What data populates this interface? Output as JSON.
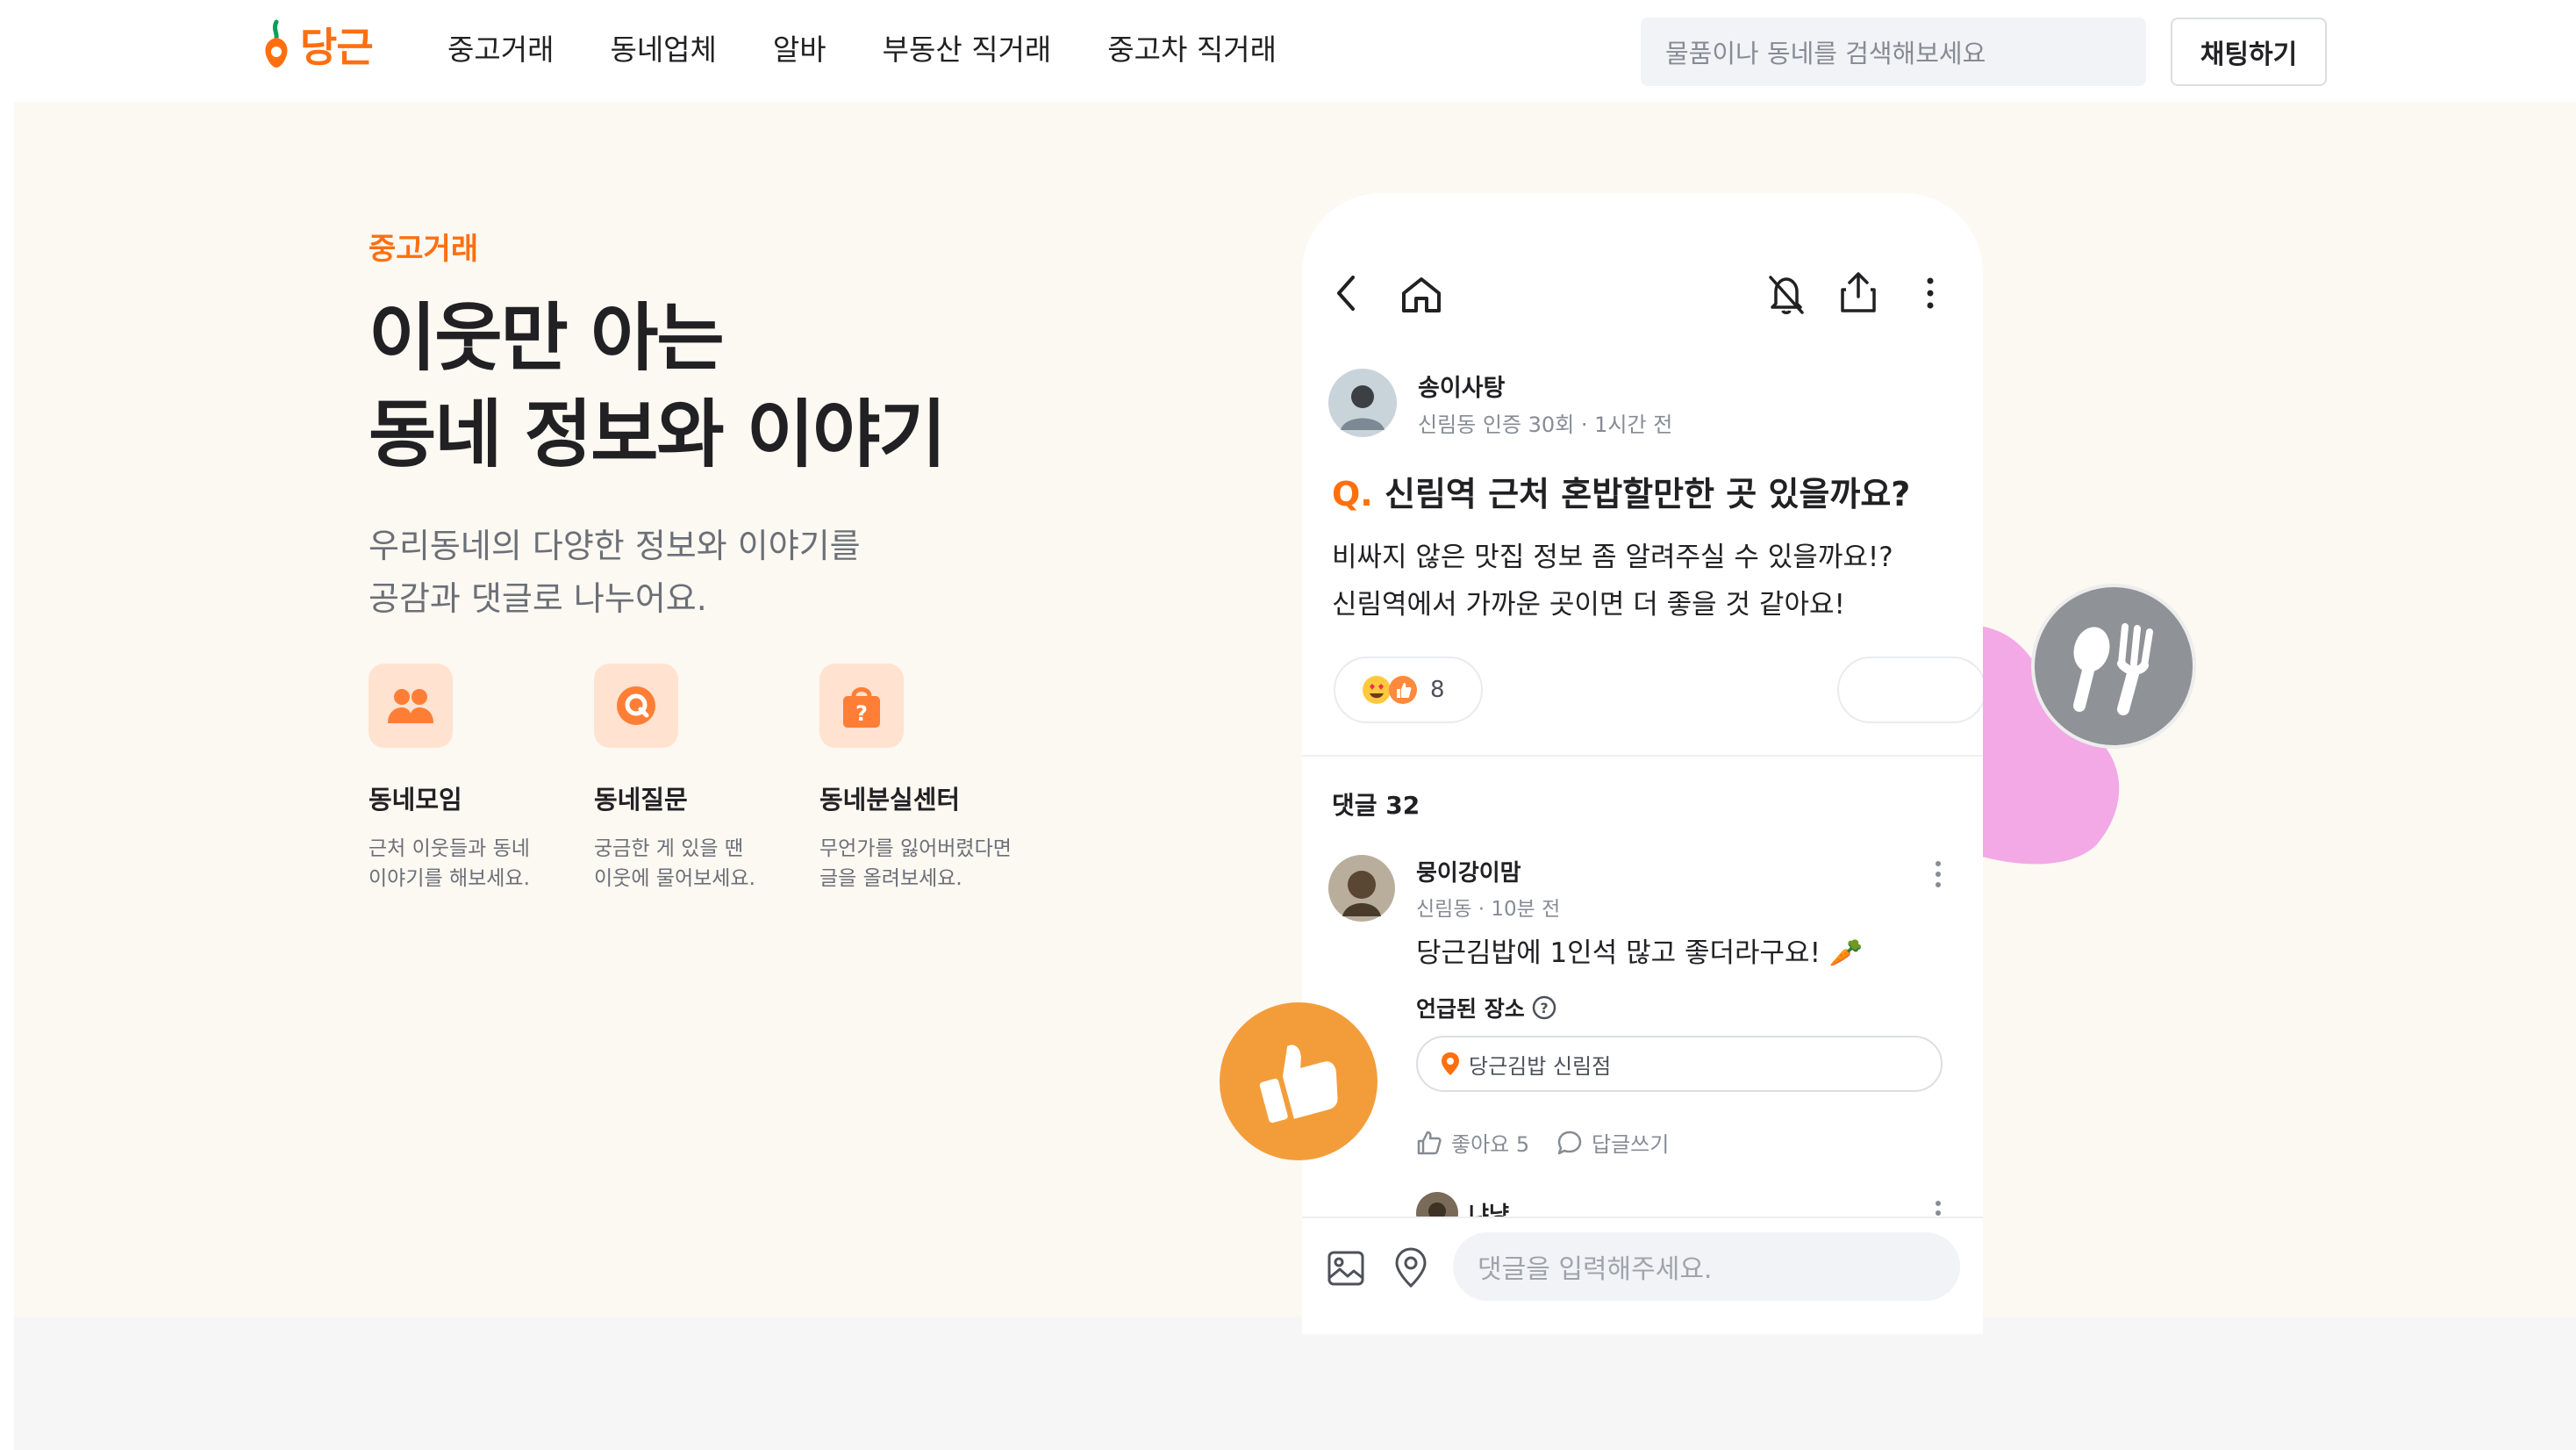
{
  "colors": {
    "brand": "#FF6F0F",
    "hero_bg": "#FCF8F2",
    "text": "#212124",
    "muted": "#868B94"
  },
  "header": {
    "logo_text": "당근",
    "nav": [
      "중고거래",
      "동네업체",
      "알바",
      "부동산 직거래",
      "중고차 직거래"
    ],
    "search_placeholder": "물품이나 동네를 검색해보세요",
    "chat_button": "채팅하기"
  },
  "hero": {
    "eyebrow": "중고거래",
    "headline": [
      "이웃만 아는",
      "동네 정보와 이야기"
    ],
    "subtext": [
      "우리동네의 다양한 정보와 이야기를",
      "공감과 댓글로 나누어요."
    ],
    "features": [
      {
        "icon": "people-icon",
        "title": "동네모임",
        "desc": [
          "근처 이웃들과 동네",
          "이야기를 해보세요."
        ]
      },
      {
        "icon": "question-bubble-icon",
        "title": "동네질문",
        "desc": [
          "궁금한 게 있을 땐",
          "이웃에 물어보세요."
        ]
      },
      {
        "icon": "lost-bag-icon",
        "title": "동네분실센터",
        "desc": [
          "무언가를 잃어버렸다면",
          "글을 올려보세요."
        ]
      }
    ]
  },
  "phone": {
    "post": {
      "author": "송이사탕",
      "meta": "신림동 인증 30회 · 1시간 전",
      "q_mark": "Q.",
      "title": "신림역 근처 혼밥할만한 곳 있을까요?",
      "body": [
        "비싸지 않은 맛집 정보 좀 알려주실 수 있을까요!?",
        "신림역에서 가까운 곳이면 더 좋을 것 같아요!"
      ],
      "reaction_count": "8"
    },
    "comments_header": "댓글 32",
    "comment": {
      "author": "뭉이강이맘",
      "meta": "신림동 · 10분 전",
      "text": "당근김밥에 1인석 많고 좋더라구요! 🥕",
      "place_label": "언급된 장소",
      "place_name": "당근김밥 신림점",
      "like": "좋아요 5",
      "reply": "답글쓰기"
    },
    "next_author": "냐냥",
    "comment_input_placeholder": "댓글을 입력해주세요."
  }
}
